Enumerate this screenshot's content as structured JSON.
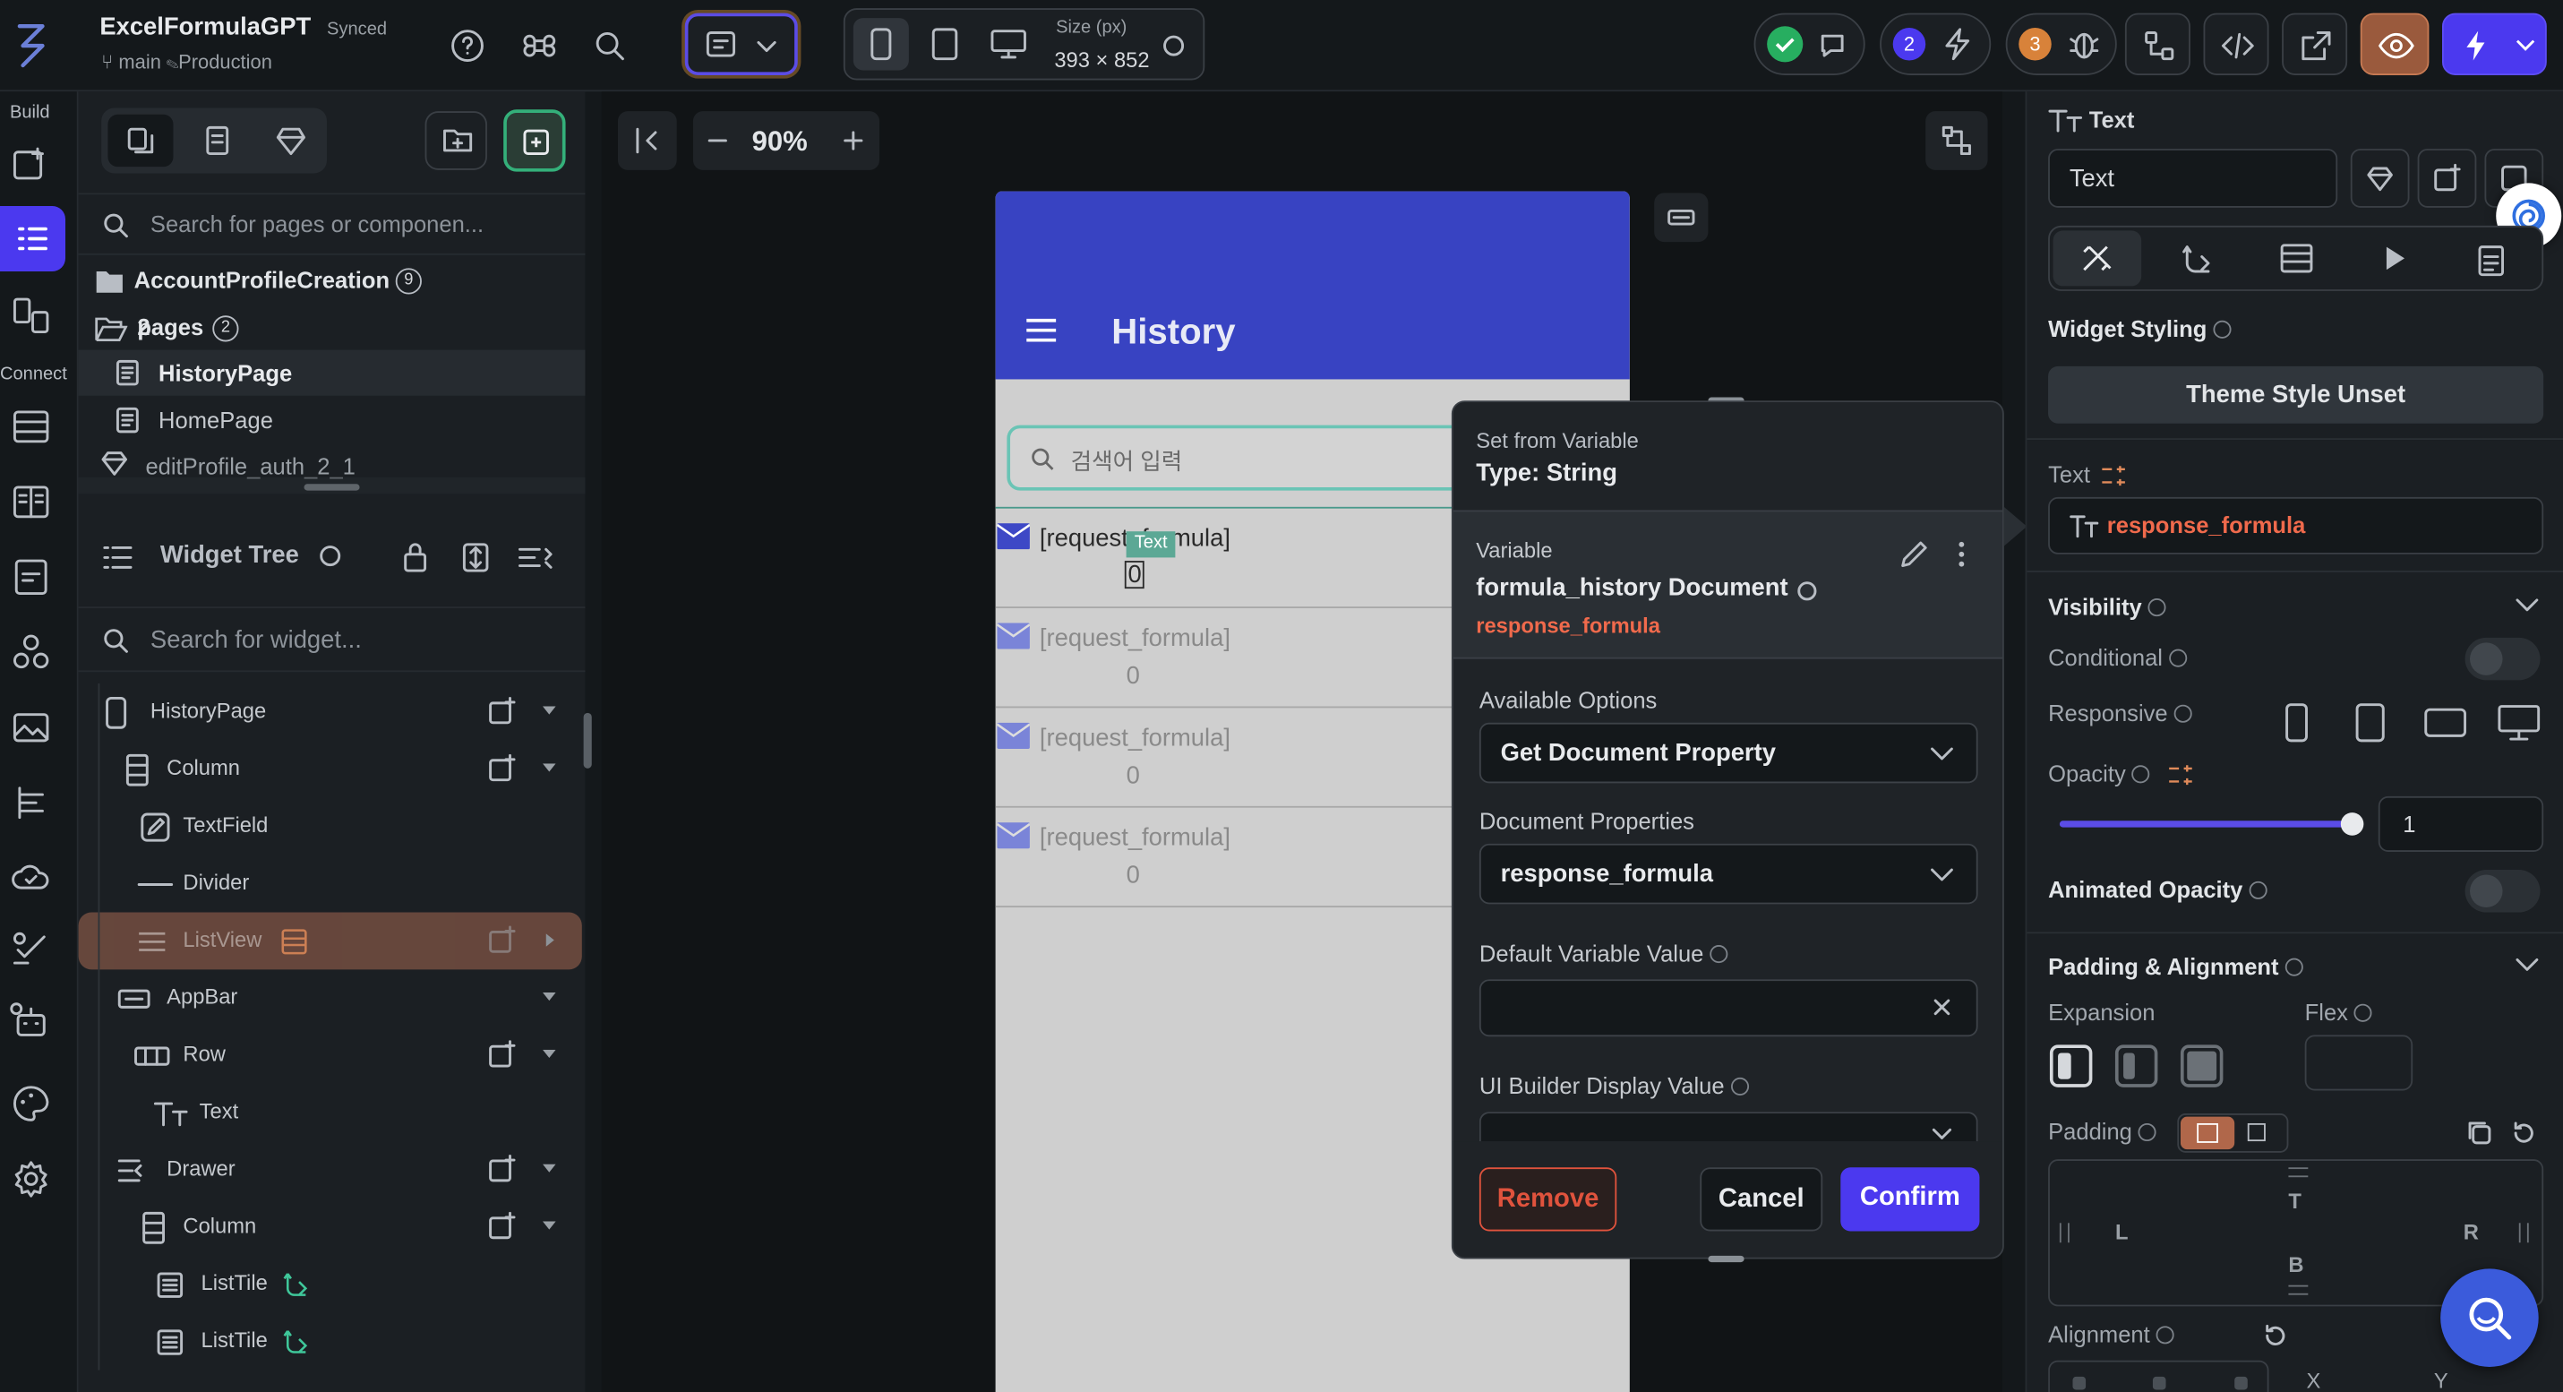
{
  "app": {
    "project_name": "ExcelFormulaGPT",
    "sync_status": "Synced",
    "branch": "main",
    "environment": "Production"
  },
  "topbar": {
    "size_label": "Size (px)",
    "size_value": "393 × 852",
    "notif_count_1": "2",
    "notif_count_2": "3"
  },
  "rail": {
    "build_label": "Build",
    "connect_label": "Connect"
  },
  "left_panel": {
    "search_placeholder": "Search for pages or componen...",
    "folder_1": "AccountProfileCreation",
    "folder_1_count": "9",
    "folder_2": "pages",
    "folder_2_count": "2",
    "pages": [
      "HistoryPage",
      "HomePage",
      "editProfile_auth_2_1"
    ],
    "widget_tree_title": "Widget Tree",
    "widget_search_placeholder": "Search for widget...",
    "tree": [
      "HistoryPage",
      "Column",
      "TextField",
      "Divider",
      "ListView",
      "AppBar",
      "Row",
      "Text",
      "Drawer",
      "Column",
      "ListTile",
      "ListTile"
    ]
  },
  "canvas": {
    "zoom": "90%",
    "app_title": "History",
    "search_hint": "검색어 입력",
    "list_items": [
      {
        "title": "[request_formula]",
        "subtitle": "0"
      },
      {
        "title": "[request_formula]",
        "subtitle": "0"
      },
      {
        "title": "[request_formula]",
        "subtitle": "0"
      },
      {
        "title": "[request_formula]",
        "subtitle": "0"
      }
    ],
    "text_tag": "Text"
  },
  "popup": {
    "header_title": "Set from Variable",
    "header_type": "Type: String",
    "variable_label": "Variable",
    "variable_name": "formula_history Document",
    "variable_field": "response_formula",
    "available_options_label": "Available Options",
    "available_options_value": "Get Document Property",
    "doc_props_label": "Document Properties",
    "doc_props_value": "response_formula",
    "default_value_label": "Default Variable Value",
    "display_value_label": "UI Builder Display Value",
    "remove": "Remove",
    "cancel": "Cancel",
    "confirm": "Confirm"
  },
  "right_panel": {
    "widget_type": "Text",
    "widget_name_value": "Text",
    "widget_styling": "Widget Styling",
    "theme_style": "Theme Style Unset",
    "text_label": "Text",
    "text_value": "response_formula",
    "visibility": "Visibility",
    "conditional": "Conditional",
    "responsive": "Responsive",
    "opacity": "Opacity",
    "opacity_value": "1",
    "animated_opacity": "Animated Opacity",
    "padding_alignment": "Padding & Alignment",
    "expansion": "Expansion",
    "flex": "Flex",
    "padding": "Padding",
    "pad_t": "T",
    "pad_l": "L",
    "pad_r": "R",
    "pad_b": "B",
    "alignment": "Alignment",
    "align_x": "X",
    "align_y": "Y"
  },
  "colors": {
    "accent": "#4b39ef",
    "appbar": "#3843c2",
    "danger": "#e0533d",
    "link": "#f06a4c"
  }
}
